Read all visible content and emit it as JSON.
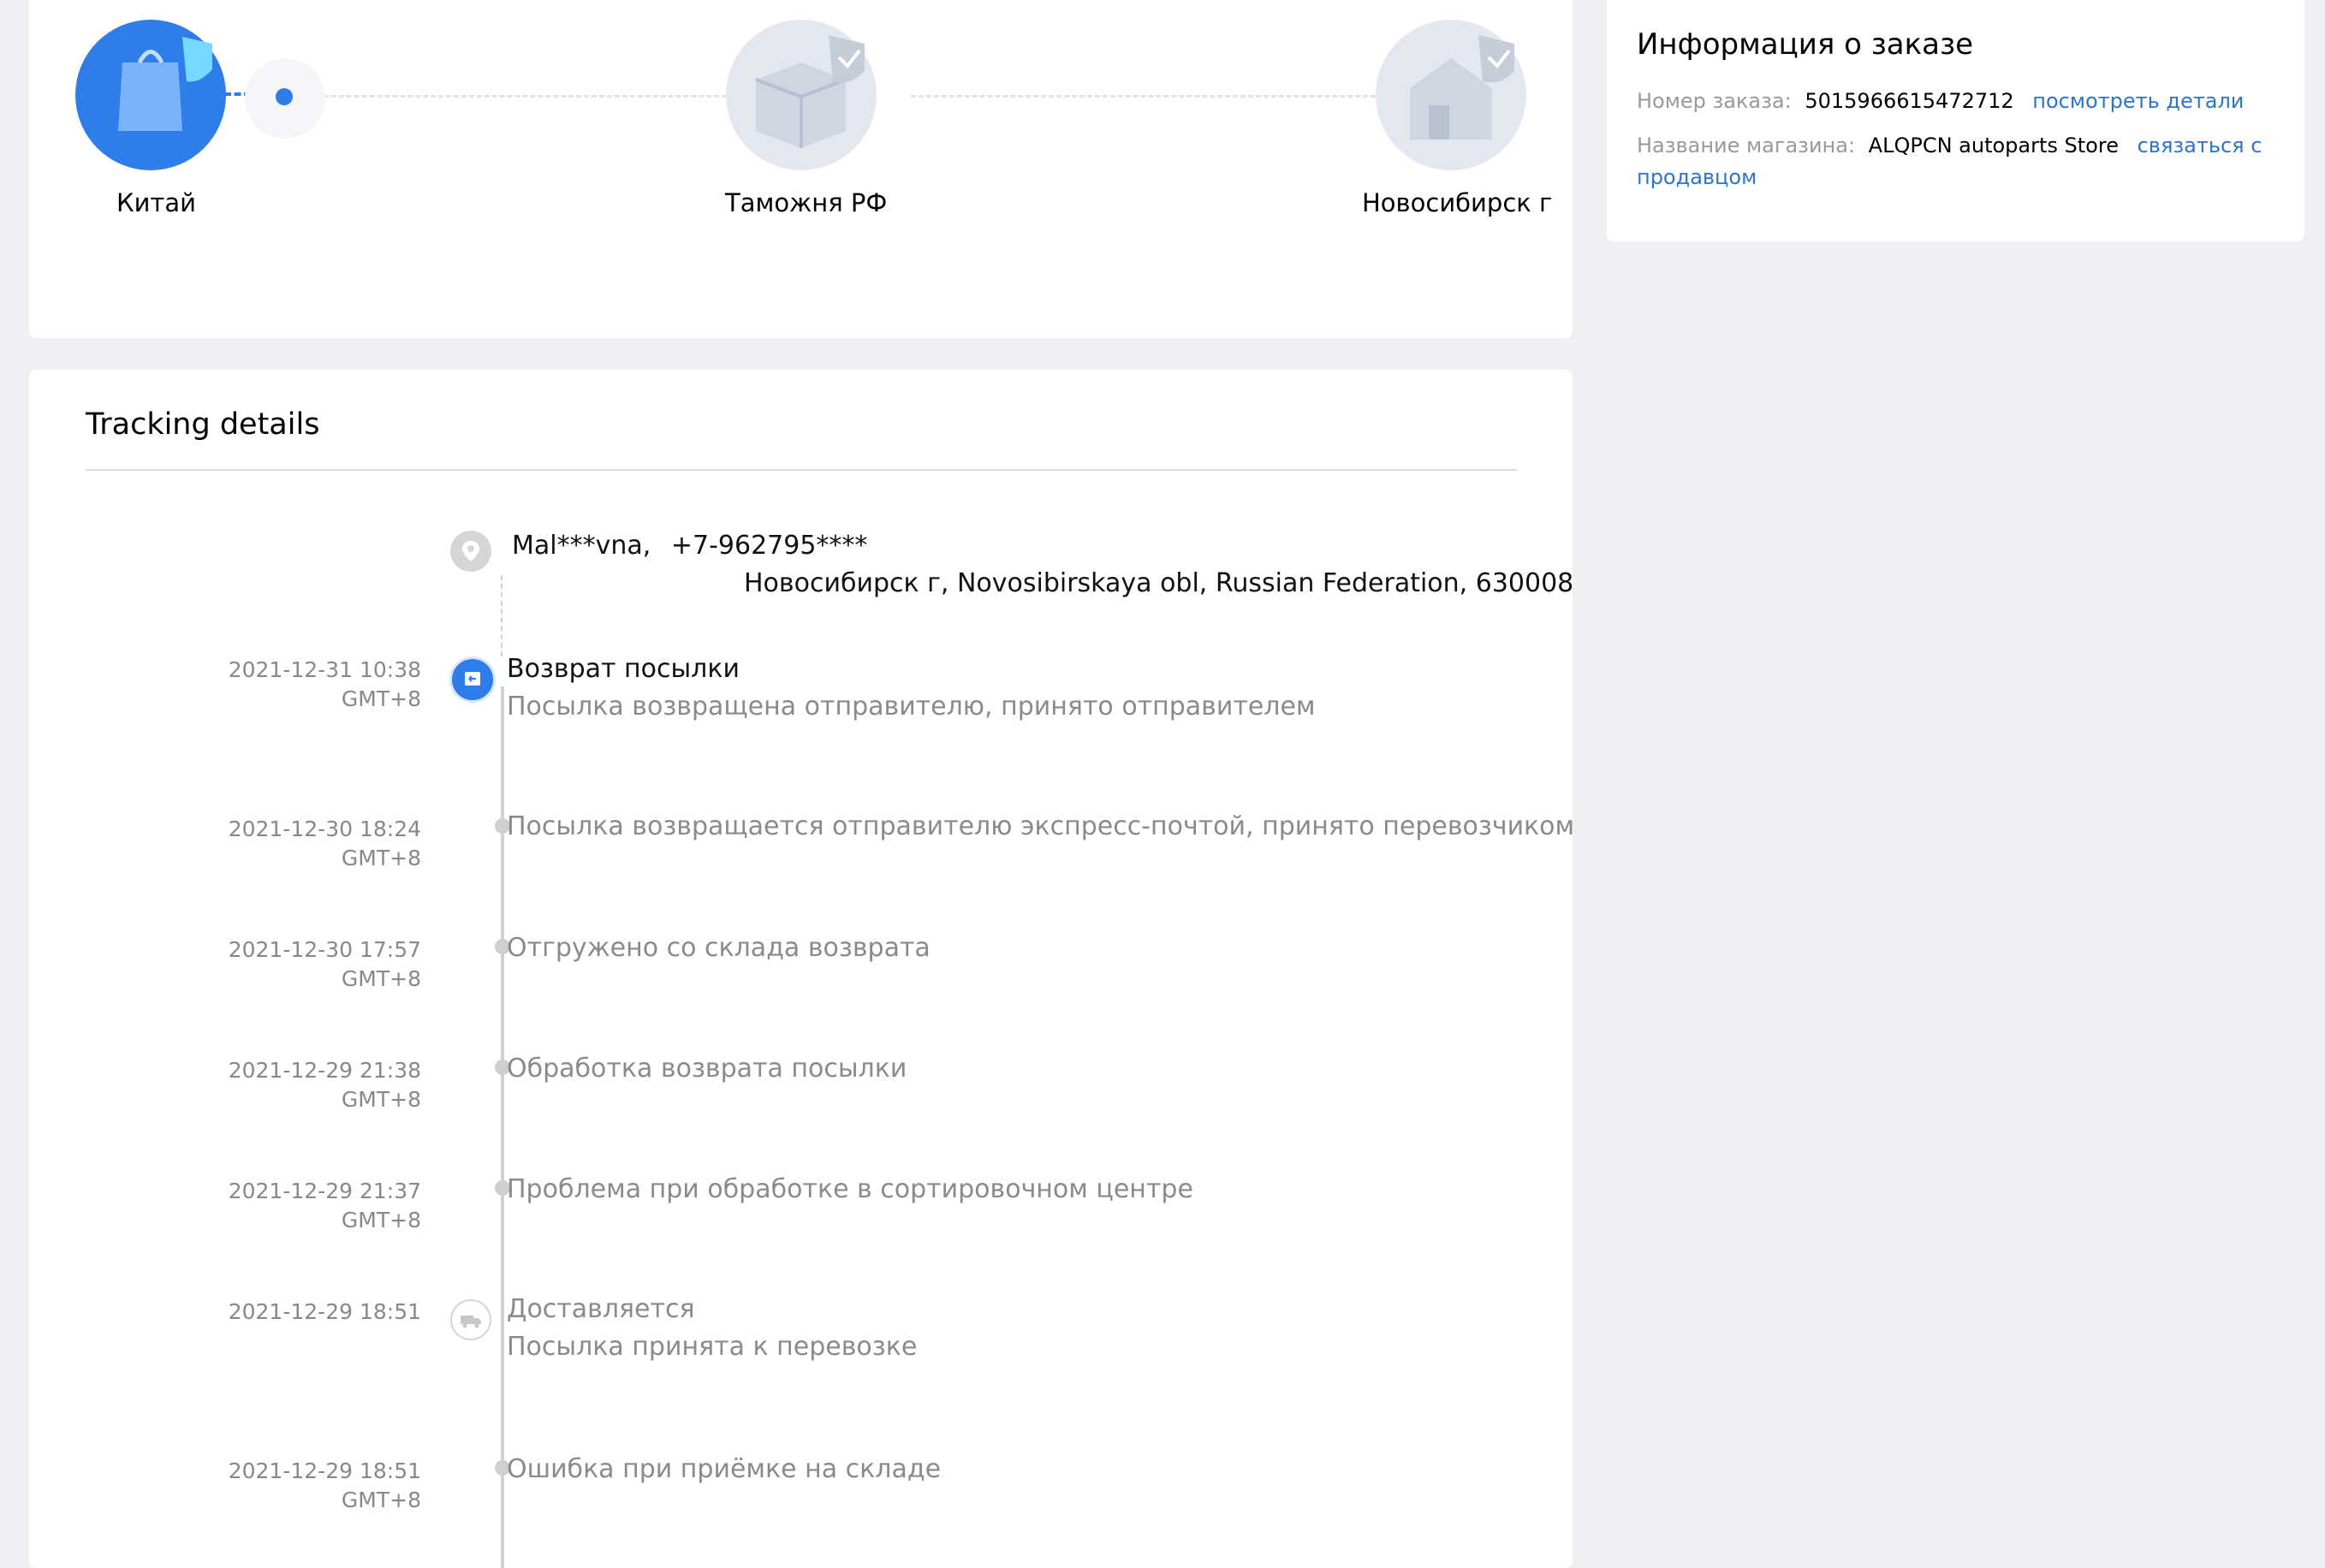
{
  "route": {
    "stages": [
      {
        "label": "Китай",
        "icon": "shopping-bag-icon"
      },
      {
        "label": "Таможня РФ",
        "icon": "customs-box-icon"
      },
      {
        "label": "Новосибирск г",
        "icon": "house-icon"
      }
    ]
  },
  "order_info": {
    "title": "Информация о заказе",
    "order_number_label": "Номер заказа:",
    "order_number": "5015966615472712",
    "view_details": "посмотреть детали",
    "store_label": "Название магазина:",
    "store_name": "ALQPCN autoparts Store",
    "contact_seller_1": "связаться с",
    "contact_seller_2": "продавцом"
  },
  "tracking": {
    "title": "Tracking details",
    "recipient": {
      "name": "Mal***vna,",
      "phone": "+7-962795****",
      "address": "Новосибирск г,  Novosibirskaya obl,  Russian Federation,  630008"
    },
    "events": [
      {
        "date": "2021-12-31 10:38",
        "tz": "GMT+8",
        "title": "Возврат посылки",
        "text": "Посылка возвращена отправителю, принято отправителем"
      },
      {
        "date": "2021-12-30 18:24",
        "tz": "GMT+8",
        "text": "Посылка возвращается отправителю экспресс-почтой, принято перевозчиком"
      },
      {
        "date": "2021-12-30 17:57",
        "tz": "GMT+8",
        "text": "Отгружено со склада возврата"
      },
      {
        "date": "2021-12-29 21:38",
        "tz": "GMT+8",
        "text": "Обработка возврата посылки"
      },
      {
        "date": "2021-12-29 21:37",
        "tz": "GMT+8",
        "text": "Проблема при обработке в сортировочном центре"
      },
      {
        "date": "2021-12-29 18:51",
        "tz": "",
        "title": "Доставляется",
        "text": "Посылка принята к перевозке"
      },
      {
        "date": "2021-12-29 18:51",
        "tz": "GMT+8",
        "text": "Ошибка при приёмке на складе"
      }
    ]
  },
  "colors": {
    "accent": "#2e74c9",
    "stage_active": "#2f7de8",
    "stage_inactive": "#e3e8f0"
  }
}
